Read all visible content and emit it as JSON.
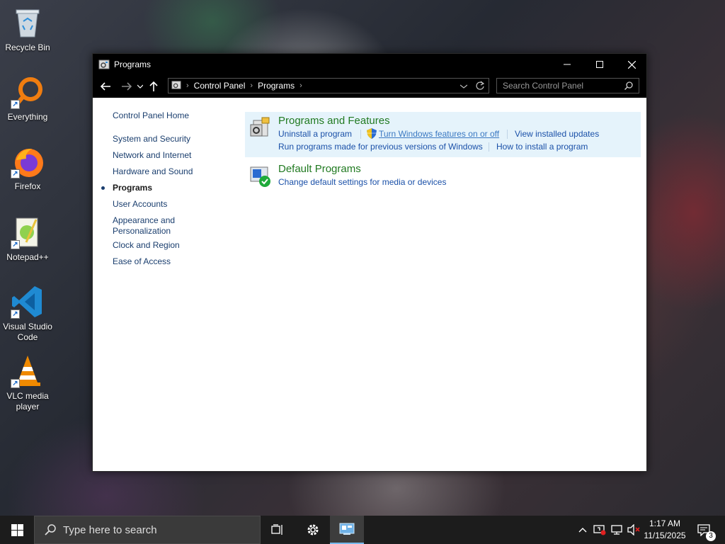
{
  "desktop": {
    "icons": [
      {
        "label": "Recycle Bin",
        "icon": "recycle-bin-icon"
      },
      {
        "label": "Everything",
        "icon": "everything-search-icon"
      },
      {
        "label": "Firefox",
        "icon": "firefox-icon"
      },
      {
        "label": "Notepad++",
        "icon": "notepad-plus-plus-icon"
      },
      {
        "label": "Visual Studio Code",
        "icon": "vscode-icon"
      },
      {
        "label": "VLC media player",
        "icon": "vlc-icon"
      }
    ]
  },
  "window": {
    "title": "Programs",
    "controls": {
      "minimize": "minimize-icon",
      "maximize": "maximize-icon",
      "close": "close-icon"
    },
    "address": {
      "crumbs": [
        "Control Panel",
        "Programs"
      ]
    },
    "search": {
      "placeholder": "Search Control Panel"
    },
    "left_nav": {
      "home": "Control Panel Home",
      "items": [
        "System and Security",
        "Network and Internet",
        "Hardware and Sound",
        "Programs",
        "User Accounts",
        "Appearance and Personalization",
        "Clock and Region",
        "Ease of Access"
      ],
      "current": "Programs"
    },
    "categories": [
      {
        "title": "Programs and Features",
        "icon": "programs-features-icon",
        "links": [
          "Uninstall a program",
          "Turn Windows features on or off",
          "View installed updates",
          "Run programs made for previous versions of Windows",
          "How to install a program"
        ]
      },
      {
        "title": "Default Programs",
        "icon": "default-programs-icon",
        "links": [
          "Change default settings for media or devices"
        ]
      }
    ]
  },
  "taskbar": {
    "search_placeholder": "Type here to search",
    "time": "1:17 AM",
    "date": "11/15/2025",
    "notification_count": "3",
    "accent": "#76b9ed"
  }
}
